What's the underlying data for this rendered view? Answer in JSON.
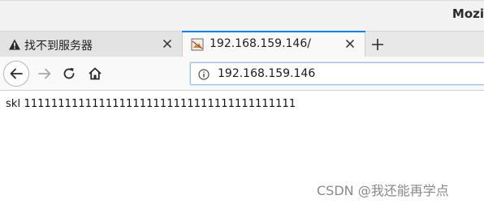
{
  "window": {
    "title": "Mozi"
  },
  "tabs": [
    {
      "label": "找不到服务器",
      "icon": "warning-icon",
      "active": false
    },
    {
      "label": "192.168.159.146/",
      "icon": "broken-image-icon",
      "active": true
    }
  ],
  "toolbar": {
    "back": "back-arrow-icon",
    "forward": "forward-arrow-icon",
    "reload": "reload-icon",
    "home": "home-icon"
  },
  "urlbar": {
    "value": "192.168.159.146",
    "icon": "info-icon"
  },
  "page": {
    "text": "skl 1111111111111111111111111111111111111111"
  },
  "watermark": {
    "text": "CSDN @我还能再学点"
  },
  "colors": {
    "accent": "#0a84ff",
    "tabstrip": "#e8e8e8",
    "toolbar": "#f9f9f9"
  }
}
